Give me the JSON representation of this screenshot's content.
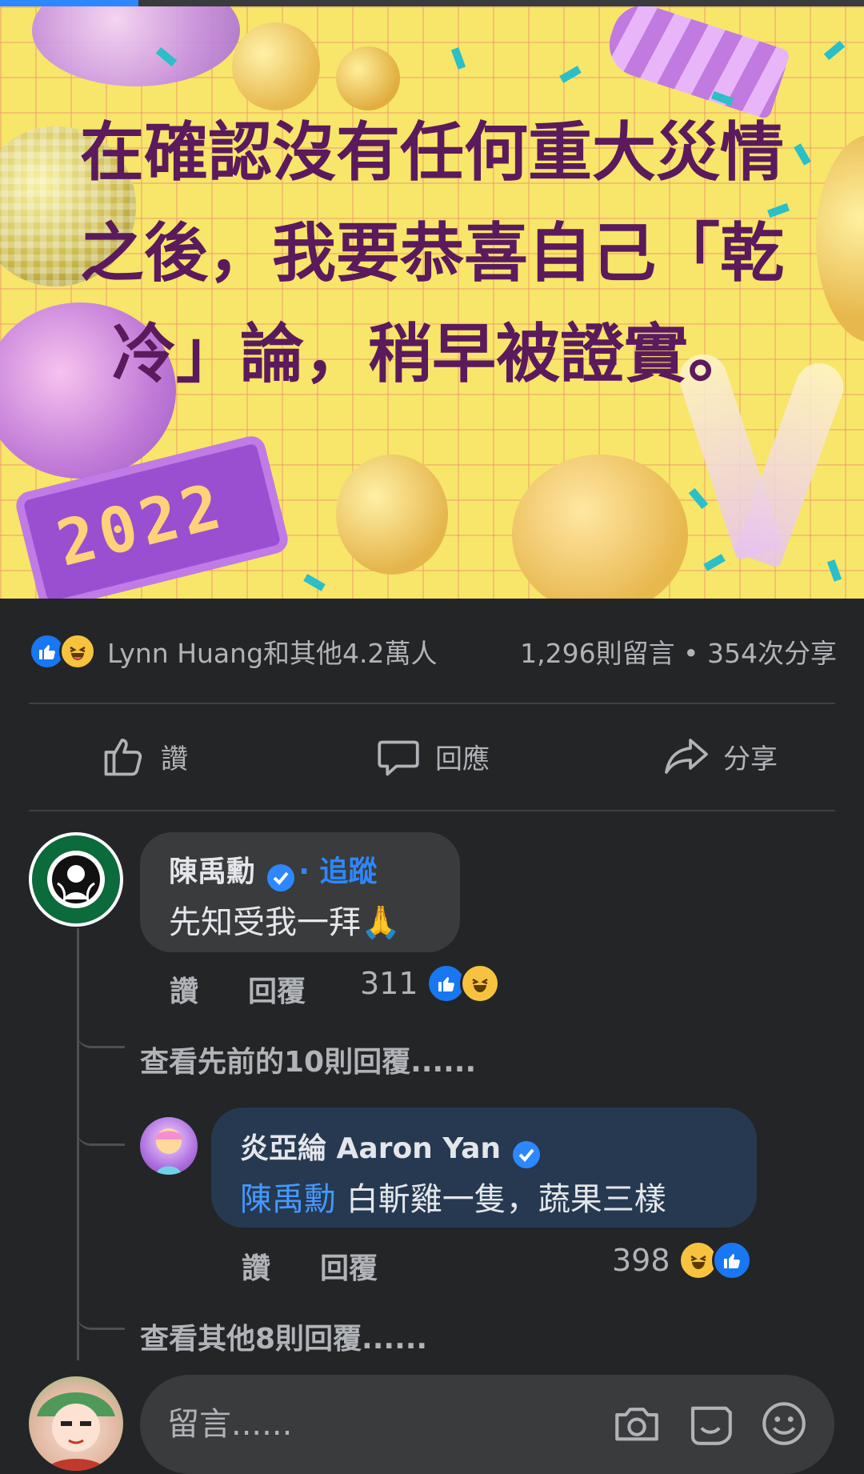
{
  "progress": {
    "value": 0.16,
    "color": "#2d88ff"
  },
  "banner": {
    "text": "在確認沒有任何重大災情之後，我要恭喜自己「乾冷」論，稍早被證實。",
    "clock": "2022"
  },
  "stats": {
    "names": "Lynn Huang和其他4.2萬人",
    "counts": "1,296則留言 • 354次分享"
  },
  "actions": {
    "like": "讚",
    "comment": "回應",
    "share": "分享"
  },
  "comment1": {
    "author": "陳禹勳",
    "follow": "· 追蹤",
    "text": "先知受我一拜🙏",
    "like": "讚",
    "reply": "回覆",
    "reactions": "311"
  },
  "view_previous": "查看先前的10則回覆......",
  "reply1": {
    "author": "炎亞綸 Aaron Yan",
    "mention": "陳禹勳",
    "text": "白斬雞一隻，蔬果三樣",
    "like": "讚",
    "reply": "回覆",
    "reactions": "398"
  },
  "view_more": "查看其他8則回覆......",
  "composer": {
    "placeholder": "留言......"
  },
  "colors": {
    "accent": "#2d88ff",
    "background": "#242526",
    "bubble": "#3a3b3c",
    "reply_bubble": "#263951"
  },
  "icons": [
    "like-reaction-icon",
    "haha-reaction-icon",
    "thumbs-up-icon",
    "comment-icon",
    "share-icon",
    "verified-icon",
    "camera-icon",
    "gif-sticker-icon",
    "emoji-icon"
  ]
}
